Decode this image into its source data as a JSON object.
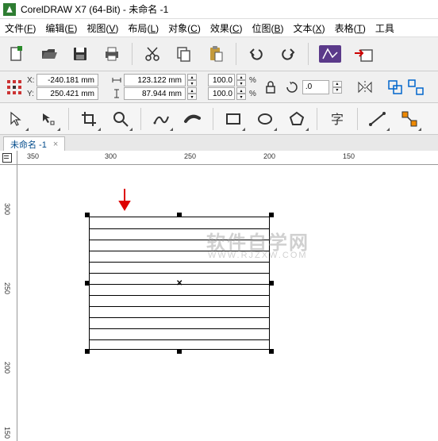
{
  "title": {
    "app": "CorelDRAW X7 (64-Bit)",
    "doc": "未命名 -1"
  },
  "menu": {
    "file": {
      "label": "文件",
      "key": "F"
    },
    "edit": {
      "label": "编辑",
      "key": "E"
    },
    "view": {
      "label": "视图",
      "key": "V"
    },
    "layout": {
      "label": "布局",
      "key": "L"
    },
    "object": {
      "label": "对象",
      "key": "C"
    },
    "effect": {
      "label": "效果",
      "key": "C"
    },
    "bitmap": {
      "label": "位图",
      "key": "B"
    },
    "text": {
      "label": "文本",
      "key": "X"
    },
    "table": {
      "label": "表格",
      "key": "T"
    },
    "tools": {
      "label": "工具",
      "key": ""
    }
  },
  "props": {
    "x_label": "X:",
    "x_value": "-240.181 mm",
    "y_label": "Y:",
    "y_value": "250.421 mm",
    "w_value": "123.122 mm",
    "h_value": "87.944 mm",
    "pct_w": "100.0",
    "pct_h": "100.0",
    "pct_sym": "%",
    "rotation": ".0"
  },
  "tab": {
    "name": "未命名 -1",
    "close": "×"
  },
  "ruler": {
    "h": [
      "350",
      "300",
      "250",
      "200",
      "150"
    ],
    "v": [
      "300",
      "250",
      "200",
      "150"
    ]
  },
  "watermark": {
    "main": "软件自学网",
    "sub": "WWW.RJZXW.COM"
  }
}
